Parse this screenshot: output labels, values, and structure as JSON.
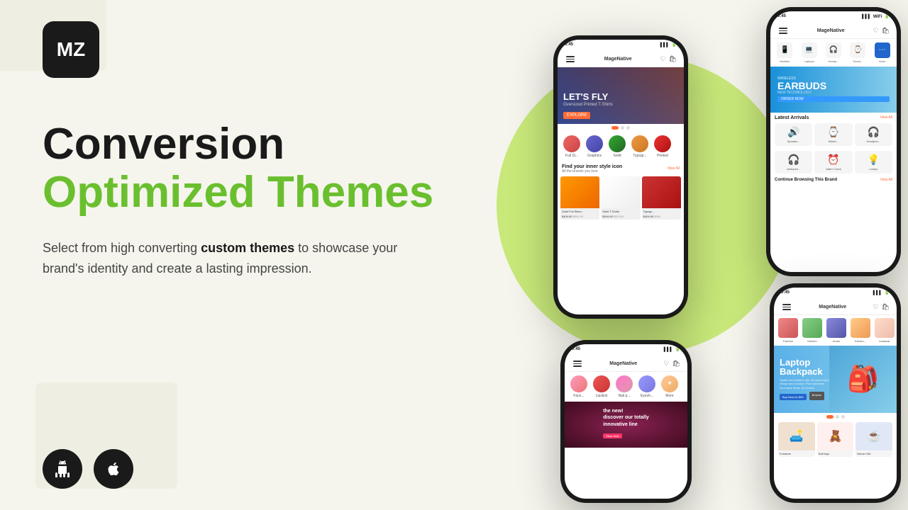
{
  "brand": {
    "logo_letters": "MZ",
    "logo_alt": "MageNative Logo"
  },
  "hero": {
    "headline_line1": "Conversion",
    "headline_line2": "Optimized Themes",
    "body_start": "Select from high converting ",
    "body_bold": "custom themes",
    "body_end": " to showcase your brand's identity and create a lasting impression."
  },
  "platforms": {
    "android_label": "Android",
    "ios_label": "iOS"
  },
  "phone1": {
    "time": "9:45",
    "app_name": "MageNative",
    "banner_text": "LET'S FLY",
    "banner_sub": "Oversized Printed T-Shirts",
    "explore_btn": "EXPLORE",
    "section_title": "Find your inner style icon",
    "section_sub": "All the brands you love",
    "view_all": "View All",
    "categories": [
      "Full Sl...",
      "Graphics",
      "Solid",
      "Typogr...",
      "Printed"
    ],
    "products": [
      {
        "name": "Solid Full Sleev...",
        "price": "$500.00",
        "old_price": "$404.60"
      },
      {
        "name": "Solid T-Shirts",
        "price": "$500.60",
        "old_price": "$404.60"
      },
      {
        "name": "Typogr...",
        "price": "$500",
        "old_price": "$404.60"
      }
    ]
  },
  "phone2": {
    "time": "9:45",
    "app_name": "MageNative",
    "categories": [
      "Mobiles",
      "Laptops",
      "Headp...",
      "Smart...",
      "More"
    ],
    "banner_small": "WIRELESS",
    "banner_title": "EARBUDS",
    "banner_tech": "NEW TECHNOLOGY",
    "order_btn": "ORDER NOW",
    "arrivals_title": "Latest Arrivals",
    "view_all": "View All",
    "arrivals": [
      {
        "icon": "🔊",
        "label": "Speaker..."
      },
      {
        "icon": "⌚",
        "label": "Watch..."
      },
      {
        "icon": "🎧",
        "label": "Headpho..."
      }
    ],
    "arrivals2": [
      {
        "icon": "🎧",
        "label": "Airdopes..."
      },
      {
        "icon": "⏰",
        "label": "Alarm Clock"
      },
      {
        "icon": "💡",
        "label": "Lamps"
      }
    ],
    "browse_title": "Continue Browsing This Brand",
    "browse_view": "View All"
  },
  "phone3": {
    "time": "9:45",
    "app_name": "MageNative",
    "categories": [
      "Face...",
      "Lipstick",
      "Nail p...",
      "Eyesh...",
      "More"
    ],
    "banner_text": "the new!\ndiscover our totally\ninnovative line",
    "shop_btn": "Shop Now"
  },
  "phone4": {
    "time": "9:45",
    "app_name": "MageNative",
    "categories": [
      "Fashion",
      "Kitchen",
      "Home",
      "Electro...",
      "footwear"
    ],
    "banner_title": "Laptop\nBackpack",
    "banner_desc": "Stylish and intuitive with the same input design and concept. Plus extensive innovative ideas. All season.",
    "buy_btn": "Buy Now for $55",
    "browse_btn": "Browse",
    "dots": 3,
    "products": [
      {
        "icon": "🛋️",
        "label": "Furniture"
      },
      {
        "icon": "🧸",
        "label": "Soft toys"
      },
      {
        "icon": "☕",
        "label": "Dinner Set"
      }
    ]
  }
}
